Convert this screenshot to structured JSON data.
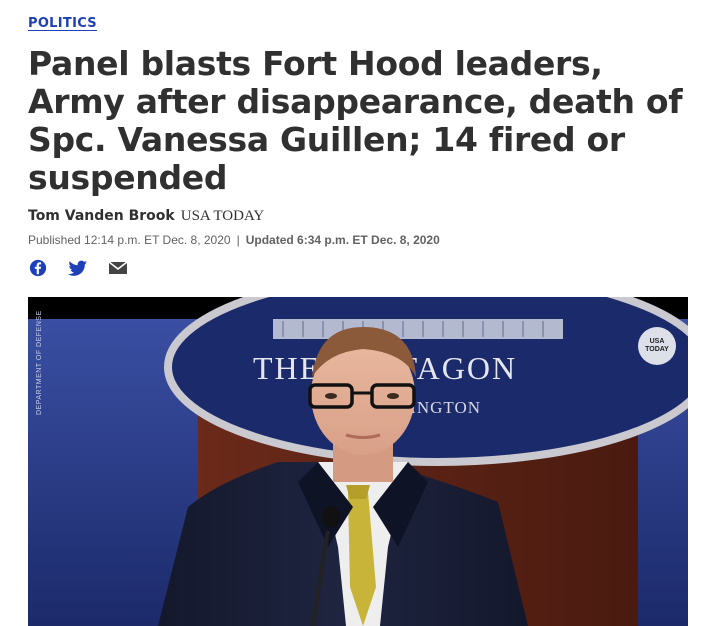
{
  "article": {
    "section": "POLITICS",
    "headline": "Panel blasts Fort Hood leaders, Army after disappearance, death of Spc. Vanessa Guillen; 14 fired or suspended",
    "author": "Tom Vanden Brook",
    "outlet": "USA TODAY",
    "published": "Published 12:14 p.m. ET Dec. 8, 2020",
    "separator": "|",
    "updated": "Updated 6:34 p.m. ET Dec. 8, 2020"
  },
  "share": {
    "icons": [
      "facebook-icon",
      "twitter-icon",
      "email-icon"
    ],
    "color": "#1d40b8"
  },
  "video": {
    "podium_sign_line1": "THE PENTAGON",
    "podium_sign_line2": "WASHINGTON",
    "side_watermark": "DEPARTMENT OF DEFENSE",
    "badge_line1": "USA",
    "badge_line2": "TODAY"
  }
}
